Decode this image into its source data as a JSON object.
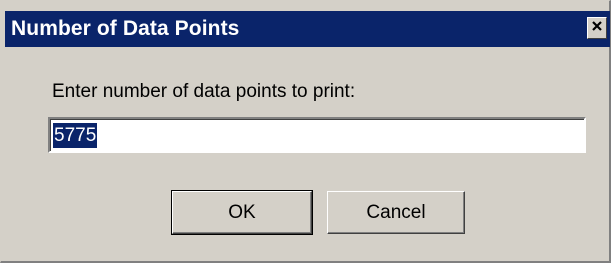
{
  "window": {
    "title": "Number of Data Points",
    "close_icon": "close-icon"
  },
  "dialog": {
    "prompt": "Enter number of data points to print:",
    "input_value": "5775"
  },
  "buttons": {
    "ok_label": "OK",
    "cancel_label": "Cancel"
  },
  "colors": {
    "titlebar": "#0a246a",
    "dialog_bg": "#d4d0c8",
    "selection": "#0a246a"
  }
}
